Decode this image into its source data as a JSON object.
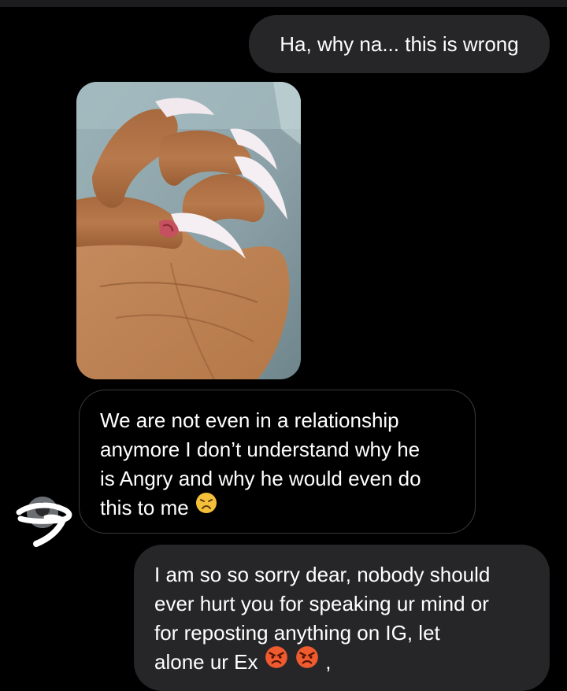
{
  "messages": [
    {
      "id": "m1",
      "direction": "outgoing",
      "text": "Ha, why na... this is wrong"
    },
    {
      "id": "m2",
      "direction": "incoming",
      "type": "photo",
      "description": "hand with long white nails and injured finger"
    },
    {
      "id": "m3",
      "direction": "incoming",
      "lines": [
        "We are not even in a relationship",
        "anymore I don’t understand why he",
        "is Angry and why he would even do",
        "this to me"
      ],
      "emoji": "disappointed-face-icon"
    },
    {
      "id": "m4",
      "direction": "outgoing",
      "lines": [
        "I am so so sorry dear, nobody should",
        "ever hurt you for speaking ur mind or",
        "for reposting anything on IG, let",
        "alone ur Ex"
      ],
      "emojis": [
        "angry-face-icon",
        "angry-face-icon"
      ],
      "trailing": ","
    }
  ],
  "colors": {
    "background": "#000000",
    "outgoing_bubble": "#262628",
    "incoming_border": "#3a3a3c",
    "text": "#ffffff"
  }
}
